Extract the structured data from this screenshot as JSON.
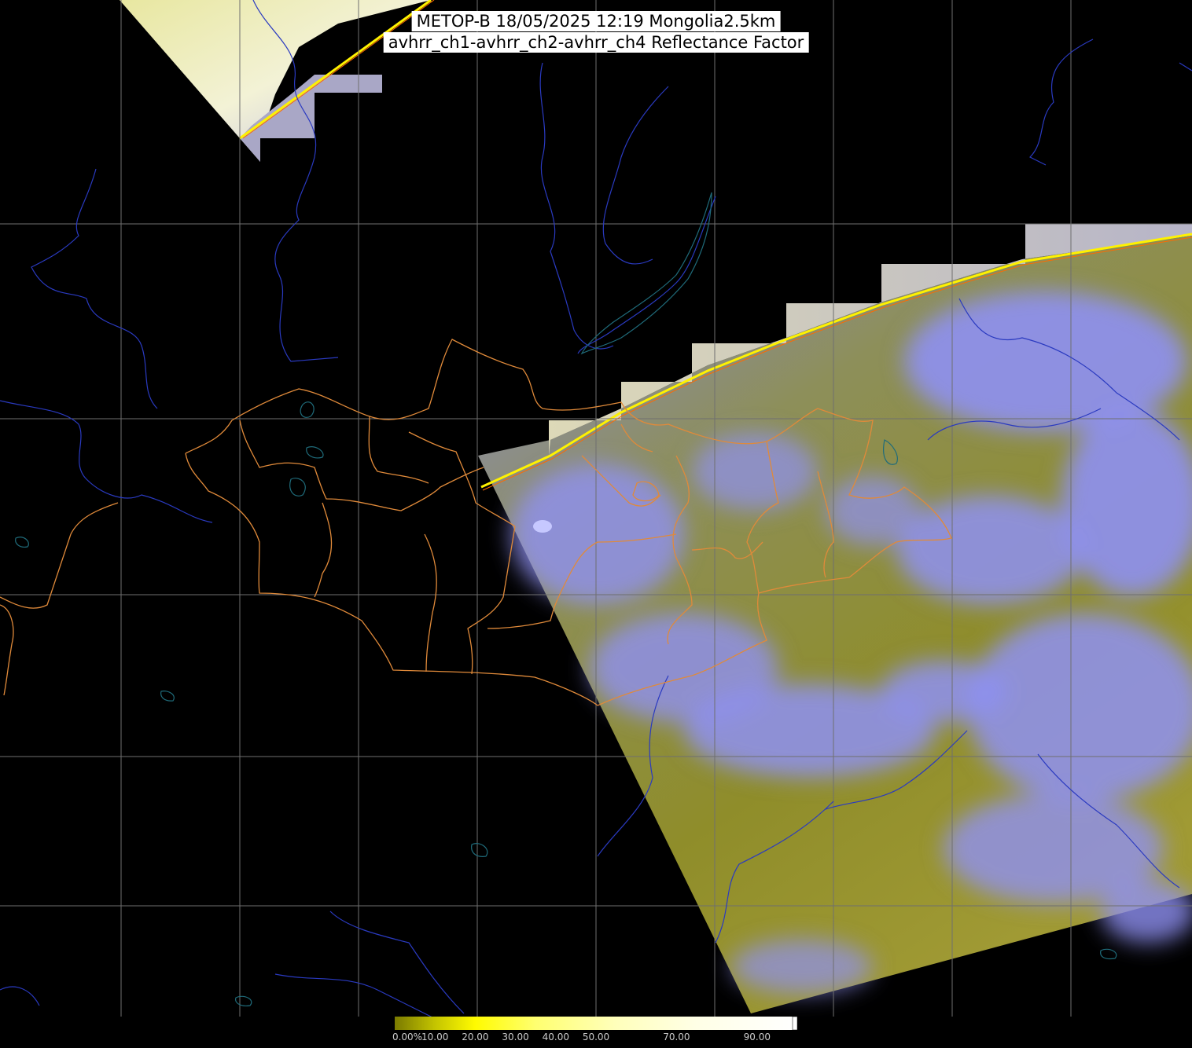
{
  "title": {
    "line1": "METOP-B 18/05/2025 12:19 Mongolia2.5km",
    "line2": "avhrr_ch1-avhrr_ch2-avhrr_ch4 Reflectance Factor"
  },
  "colors": {
    "background": "#000000",
    "graticule": "#6f6f6f",
    "rivers_coast": "#2a3ac0",
    "lakes": "#1f6b7a",
    "admin_borders": "#e08a3a",
    "clear_land": "#8a8a2a",
    "cloud": "#8a8cf0",
    "scan_edge": "#fff200"
  },
  "colorbar": {
    "scale_name": "reflectance-factor",
    "ticks": [
      "0.00%",
      "10.00",
      "20.00",
      "30.00",
      "40.00",
      "50.00",
      "70.00",
      "90.00"
    ],
    "tick_values": [
      0,
      10,
      20,
      30,
      40,
      50,
      70,
      90
    ],
    "stops": [
      {
        "value": 0,
        "color": "#7a7a00"
      },
      {
        "value": 10,
        "color": "#c4c400"
      },
      {
        "value": 20,
        "color": "#fffb00"
      },
      {
        "value": 35,
        "color": "#ffff70"
      },
      {
        "value": 55,
        "color": "#ffffbb"
      },
      {
        "value": 75,
        "color": "#ffffe6"
      },
      {
        "value": 100,
        "color": "#ffffff"
      }
    ],
    "range": [
      0,
      100
    ]
  },
  "map": {
    "region": "Mongolia",
    "satellite": "METOP-B",
    "resolution": "2.5km"
  }
}
